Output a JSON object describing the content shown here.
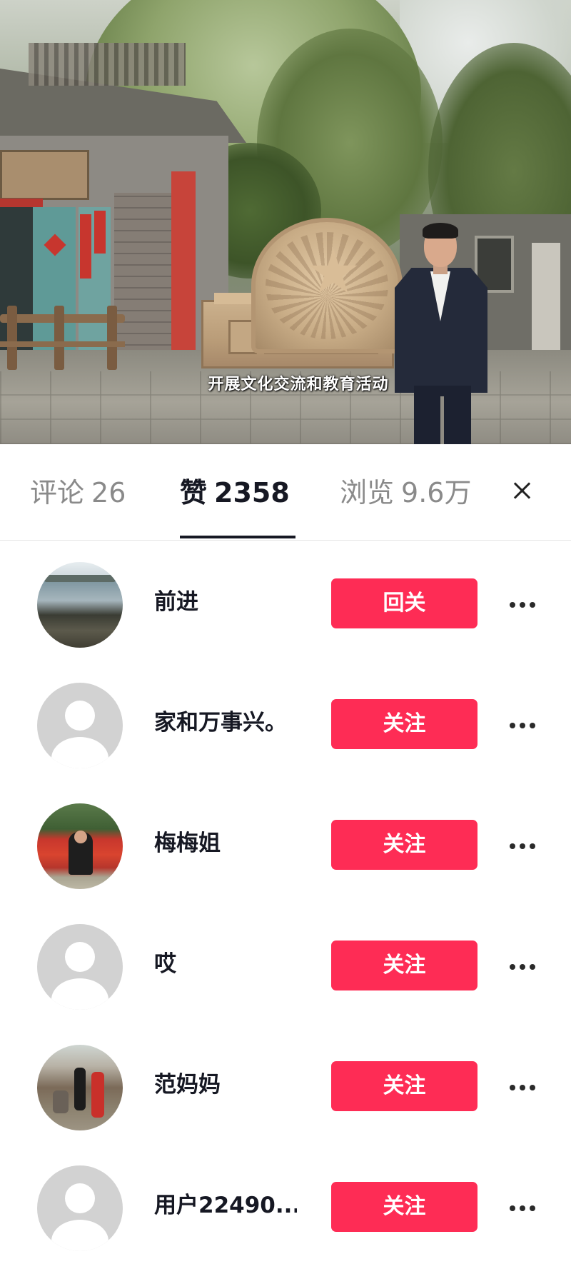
{
  "video": {
    "subtitle": "开展文化交流和教育活动"
  },
  "tabs": {
    "comments_label": "评论",
    "comments_count": "26",
    "likes_label": "赞",
    "likes_count": "2358",
    "views_label": "浏览",
    "views_count": "9.6万",
    "active": "likes"
  },
  "icons": {
    "close": "close-icon",
    "more": "more-icon",
    "default_avatar": "default-avatar-icon"
  },
  "colors": {
    "follow_button": "#fe2c55",
    "active_tab_text": "#161823",
    "inactive_tab_text": "#8a8a8a"
  },
  "users": [
    {
      "name": "前进",
      "button": "回关",
      "avatar": "lake-photo"
    },
    {
      "name": "家和万事兴。",
      "button": "关注",
      "avatar": "default"
    },
    {
      "name": "梅梅姐",
      "button": "关注",
      "avatar": "flowers-photo"
    },
    {
      "name": "哎",
      "button": "关注",
      "avatar": "default"
    },
    {
      "name": "范妈妈",
      "button": "关注",
      "avatar": "family-photo"
    },
    {
      "name": "用户22490...",
      "button": "关注",
      "avatar": "default"
    }
  ]
}
